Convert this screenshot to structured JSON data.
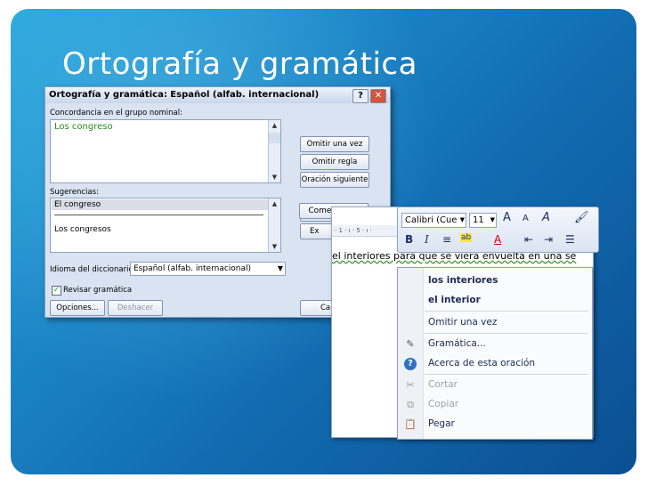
{
  "slide": {
    "title": "Ortografía y gramática"
  },
  "dialog": {
    "title": "Ortografía y gramática: Español (alfab. internacional)",
    "help_glyph": "?",
    "close_glyph": "✕",
    "concordancia_label": "Concordancia en el grupo nominal:",
    "concordancia_text": "Los congreso",
    "sugerencias_label": "Sugerencias:",
    "suggestions": [
      "El congreso",
      "Los congresos"
    ],
    "idioma_label": "Idioma del diccionario:",
    "idioma_value": "Español (alfab. internacional)",
    "revisar_label": "Revisar gramática",
    "buttons": {
      "omitir_una_vez": "Omitir una vez",
      "omitir_regla": "Omitir regla",
      "oracion_siguiente": "Oración siguiente",
      "cambiar_partial": "Ca",
      "explicar_partial": "Ex",
      "opciones": "Opciones...",
      "deshacer": "Deshacer",
      "cancelar_partial": "Ca"
    },
    "comentarios_partial": "Comentarios"
  },
  "document": {
    "ruler_text": "· 1 · ı · 5 · ı ·",
    "sentence_before": "el interio",
    "sentence_rest": "res para que se viera envuelta en una se"
  },
  "mini_toolbar": {
    "font_name": "Calibri (Cue",
    "font_size": "11",
    "grow_font": "A",
    "shrink_font": "A",
    "bold": "B",
    "italic": "I",
    "font_color": "A"
  },
  "context_menu": {
    "suggestions": [
      "los interiores",
      "el interior"
    ],
    "items": [
      "Omitir una vez",
      "Gramática...",
      "Acerca de esta oración",
      "Cortar",
      "Copiar",
      "Pegar"
    ]
  },
  "colors": {
    "slide_blue": "#1b87c8",
    "suggestion_green": "#2b8a1e",
    "menu_text": "#1c2a52"
  }
}
